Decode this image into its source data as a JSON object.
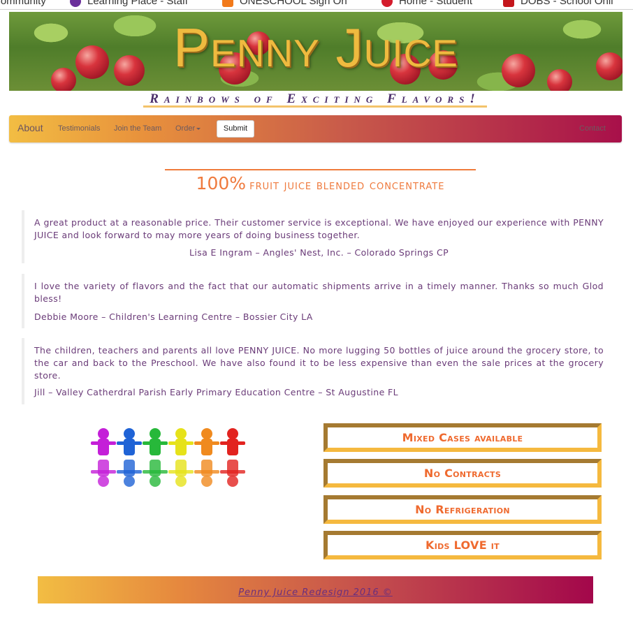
{
  "bookmarks": [
    {
      "label": "Community",
      "color": "#8b8b8b"
    },
    {
      "label": "Learning Place - Staff",
      "color": "#6a2f9a"
    },
    {
      "label": "ONESCHOOL Sign On",
      "color": "#f27a1a"
    },
    {
      "label": "Home - Student",
      "color": "#d41c2c"
    },
    {
      "label": "DOBS - School Onli",
      "color": "#c4161c"
    }
  ],
  "header": {
    "title": "Penny Juice",
    "tagline": "Rainbows of Exciting Flavors!"
  },
  "nav": {
    "brand": "About",
    "links": [
      "Testimonials",
      "Join the Team",
      "Order"
    ],
    "submit_label": "Submit",
    "contact": "Contact"
  },
  "headline": {
    "big": "100%",
    "small": "fruit juice blended concentrate"
  },
  "testimonials": [
    {
      "text": "A great product at a reasonable price. Their customer service is exceptional. We have enjoyed our experience with PENNY JUICE and look forward to may more years of doing business together.",
      "cite": "Lisa E Ingram – Angles' Nest, Inc. – Colorado Springs CP"
    },
    {
      "text": "I love the variety of flavors and the fact that our automatic shipments arrive in a timely manner. Thanks so much Glod bless!",
      "cite": "Debbie Moore – Children's Learning Centre – Bossier City LA"
    },
    {
      "text": "The children, teachers and parents all love PENNY JUICE. No more lugging 50 bottles of juice around the grocery store, to the car and back to the Preschool. We have also found it to be less expensive than even the sale prices at the grocery store.",
      "cite": "Jill – Valley Catherdral Parish Early Primary Education Centre – St Augustine FL"
    }
  ],
  "features": [
    "Mixed Cases available",
    "No Contracts",
    "No Refrigeration",
    "Kids LOVE it"
  ],
  "kids_colors": [
    "#c41fd8",
    "#1f63d6",
    "#27b83a",
    "#e6e21a",
    "#f08a1e",
    "#e2231f"
  ],
  "footer": "Penny Juice Redesign 2016 ©"
}
